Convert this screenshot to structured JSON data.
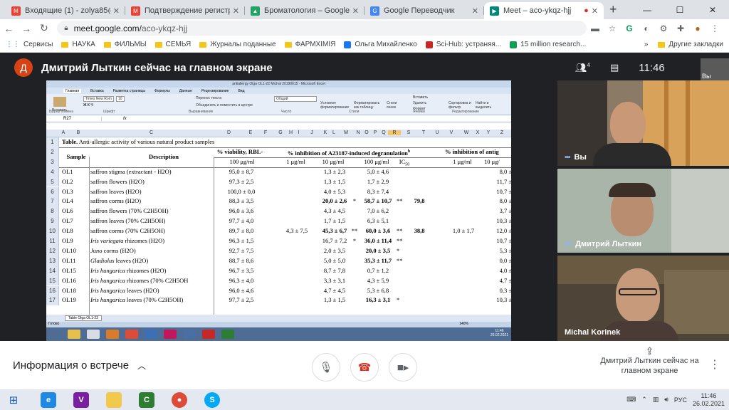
{
  "browser": {
    "tabs": [
      {
        "title": "Входящие (1) - zolya85@gmail",
        "color": "#ea4335",
        "letter": "M"
      },
      {
        "title": "Подтверждение регистрации",
        "color": "#ea4335",
        "letter": "M"
      },
      {
        "title": "Броматология – Google Диск",
        "color": "#1fa463",
        "letter": "▲"
      },
      {
        "title": "Google Переводчик",
        "color": "#4285f4",
        "letter": "G"
      },
      {
        "title": "Meet – aco-ykqz-hjj",
        "color": "#00897b",
        "letter": "▶"
      }
    ],
    "url_host": "meet.google.com/",
    "url_path": "aco-ykqz-hjj",
    "bookmarks": [
      "Сервисы",
      "НАУКА",
      "ФИЛЬМЫ",
      "СЕМЬЯ",
      "Журналы поданные",
      "ФАРМХІМІЯ",
      "Ольга Михайленко",
      "Sci-Hub: устраняя...",
      "15 million research..."
    ],
    "other_bookmarks": "Другие закладки"
  },
  "meet": {
    "presenter_initial": "Д",
    "presenter_title": "Дмитрий Лыткин сейчас на главном экране",
    "participants_count": "4",
    "time": "11:46",
    "self_label": "Вы",
    "tiles": [
      {
        "name": "Вы"
      },
      {
        "name": "Дмитрий Лыткин"
      },
      {
        "name": "Michal Korinek"
      }
    ],
    "meeting_info": "Информация о встрече",
    "presenting_label": "Дмитрий Лыткин сейчас на главном экране"
  },
  "excel": {
    "title": "antiallergy Olga OL1-22 Michal 20190615 - Microsoft Excel",
    "ribbon_tabs": [
      "Главная",
      "Вставка",
      "Разметка страницы",
      "Формулы",
      "Данные",
      "Рецензирование",
      "Вид"
    ],
    "groups": [
      "Буфер обмена",
      "Шрифт",
      "Выравнивание",
      "Число",
      "Стили",
      "Ячейки",
      "Редактирование"
    ],
    "font_name": "Times New Rom",
    "font_size": "10",
    "number_format": "Общий",
    "ribbon_labels": {
      "insert": "Вставить",
      "wrap": "Перенос текста",
      "merge": "Объединить и поместить в центре",
      "cond": "Условное форматирование",
      "as_table": "Форматировать как таблицу",
      "styles": "Стили ячеек",
      "ins": "Вставить",
      "del": "Удалить",
      "fmt": "Формат",
      "sort": "Сортировка и фильтр",
      "find": "Найти и выделить"
    },
    "name_box": "R27",
    "fx": "fx",
    "columns": [
      "A",
      "B",
      "C",
      "D",
      "E",
      "F",
      "G",
      "H",
      "I",
      "J",
      "K",
      "L",
      "M",
      "N",
      "O",
      "P",
      "Q",
      "R",
      "S",
      "T",
      "U",
      "V",
      "W",
      "X",
      "Y",
      "Z"
    ],
    "sheet_tab": "Table Olga OL1-22",
    "status": "Готово",
    "zoom": "140%",
    "clock": "11:46",
    "date": "26.02.2021",
    "table": {
      "title_bold": "Table.",
      "title_rest": " Anti-allergic activity of various natural product samples",
      "h_sample": "Sample",
      "h_desc": "Description",
      "h_viab": "% viability, RBL-",
      "h_inhib": "% inhibition of A23187-induced degranulation",
      "h_inhib_sup": "b",
      "h_inhib2": "% inhibition of antig",
      "h_100": "100 μg/ml",
      "h_1": "1 μg/ml",
      "h_10": "10 μg/ml",
      "h_100b": "100 μg/ml",
      "h_ic": "IC",
      "h_ic_sub": "50",
      "h_1b": "1 μg/ml",
      "h_10b": "10 μg/",
      "rows": [
        {
          "r": "4",
          "s": "OL1",
          "d": "saffron stigma (extractant - H2O)",
          "v": "95,0 ± 8,7",
          "i1": "",
          "i10": "1,3 ± 2,3",
          "m10": "",
          "i100": "5,0 ± 4,6",
          "m100": "",
          "ic": "",
          "j1": "",
          "j10": "8,0 ±"
        },
        {
          "r": "5",
          "s": "OL2",
          "d": "saffron flowers (H2O)",
          "v": "97,3 ± 2,5",
          "i1": "",
          "i10": "1,3 ± 1,5",
          "m10": "",
          "i100": "1,7 ± 2,9",
          "m100": "",
          "ic": "",
          "j1": "",
          "j10": "11,7 ±"
        },
        {
          "r": "6",
          "s": "OL3",
          "d": "saffron leaves (H2O)",
          "v": "100,0 ± 0,0",
          "i1": "",
          "i10": "4,0 ± 5,3",
          "m10": "",
          "i100": "8,3 ± 7,4",
          "m100": "",
          "ic": "",
          "j1": "",
          "j10": "10,7 ±"
        },
        {
          "r": "7",
          "s": "OL4",
          "d": "saffron corms (H2O)",
          "v": "88,3 ± 3,5",
          "i1": "",
          "i10": "20,0 ± 2,6",
          "m10": "*",
          "i100": "58,7 ± 10,7",
          "m100": "**",
          "ic": "79,8",
          "j1": "",
          "j10": "8,0 ±",
          "b10": true,
          "b100": true
        },
        {
          "r": "8",
          "s": "OL6",
          "d": "saffron flowers (70% C2H5OH)",
          "v": "96,0 ± 3,6",
          "i1": "",
          "i10": "4,3 ± 4,5",
          "m10": "",
          "i100": "7,0 ± 6,2",
          "m100": "",
          "ic": "",
          "j1": "",
          "j10": "3,7 ±"
        },
        {
          "r": "9",
          "s": "OL7",
          "d": "saffron leaves (70% C2H5OH)",
          "v": "97,7 ± 4,0",
          "i1": "",
          "i10": "1,7 ± 1,5",
          "m10": "",
          "i100": "6,3 ± 5,1",
          "m100": "",
          "ic": "",
          "j1": "",
          "j10": "10,3 ±"
        },
        {
          "r": "10",
          "s": "OL8",
          "d": "saffron corms (70% C2H5OH)",
          "v": "89,7 ± 8,0",
          "i1": "4,3 ± 7,5",
          "i10": "45,3 ± 6,7",
          "m10": "**",
          "i100": "60,0 ± 3,6",
          "m100": "**",
          "ic": "38,8",
          "j1": "1,0 ± 1,7",
          "j10": "12,0 ±",
          "b10": true,
          "b100": true
        },
        {
          "r": "11",
          "s": "OL9",
          "d_it": "Iris variegata",
          "d": " rhizomes (H2O)",
          "v": "96,3 ± 1,5",
          "i1": "",
          "i10": "16,7 ± 7,2",
          "m10": "*",
          "i100": "36,0 ± 11,4",
          "m100": "**",
          "ic": "",
          "j1": "",
          "j10": "10,7 ±",
          "b100": true
        },
        {
          "r": "12",
          "s": "OL10",
          "d_it": "Juno",
          "d": " corms (H2O)",
          "v": "92,7 ± 7,5",
          "i1": "",
          "i10": "2,0 ± 3,5",
          "m10": "",
          "i100": "20,0 ± 3,5",
          "m100": "*",
          "ic": "",
          "j1": "",
          "j10": "5,3 ±",
          "b100": true
        },
        {
          "r": "13",
          "s": "OL11",
          "d_it": "Gladiolus",
          "d": " leaves (H2O)",
          "v": "88,7 ± 8,6",
          "i1": "",
          "i10": "5,0 ± 5,0",
          "m10": "",
          "i100": "35,3 ± 11,7",
          "m100": "**",
          "ic": "",
          "j1": "",
          "j10": "0,0 ±",
          "b100": true
        },
        {
          "r": "14",
          "s": "OL15",
          "d_it": "Iris hungarica",
          "d": " rhizomes (H2O)",
          "v": "96,7 ± 3,5",
          "i1": "",
          "i10": "8,7 ± 7,8",
          "m10": "",
          "i100": "0,7 ± 1,2",
          "m100": "",
          "ic": "",
          "j1": "",
          "j10": "4,0 ±"
        },
        {
          "r": "15",
          "s": "OL16",
          "d_it": "Iris hungarica",
          "d": " rhizomes (70% C2H5OH",
          "v": "96,3 ± 4,0",
          "i1": "",
          "i10": "3,3 ± 3,1",
          "m10": "",
          "i100": "4,3 ± 5,9",
          "m100": "",
          "ic": "",
          "j1": "",
          "j10": "4,7 ±"
        },
        {
          "r": "16",
          "s": "OL18",
          "d_it": "Iris hungarica",
          "d": " leaves (H2O)",
          "v": "96,0 ± 4,6",
          "i1": "",
          "i10": "4,7 ± 4,5",
          "m10": "",
          "i100": "5,3 ± 6,8",
          "m100": "",
          "ic": "",
          "j1": "",
          "j10": "0,3 ±"
        },
        {
          "r": "17",
          "s": "OL19",
          "d_it": "Iris hungarica",
          "d": " leaves (70% C2H5OH)",
          "v": "97,7 ± 2,5",
          "i1": "",
          "i10": "1,3 ± 1,5",
          "m10": "",
          "i100": "16,3 ± 3,1",
          "m100": "*",
          "ic": "",
          "j1": "",
          "j10": "10,3 ±",
          "b100": true
        }
      ]
    }
  },
  "windows": {
    "lang": "РУС",
    "time": "11:46",
    "date": "26.02.2021"
  }
}
